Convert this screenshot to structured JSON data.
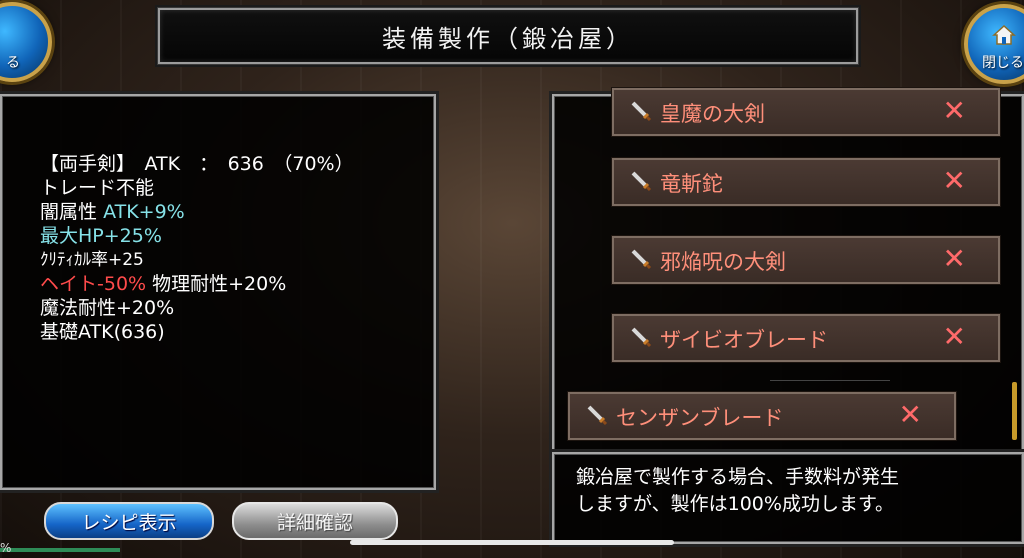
{
  "header": {
    "title": "装備製作（鍛冶屋）"
  },
  "nav": {
    "left_button_label": "る",
    "right_button_label": "閉じる",
    "right_button_icon": "home-icon"
  },
  "item_details": {
    "lines": [
      "【両手剣】　ATK　：　636　（70%）",
      "トレード不能",
      "闇属性",
      "ATK+9%",
      "最大HP+25%",
      "ｸﾘﾃｨｶﾙ率+25",
      "ヘイト-50%",
      "物理耐性+20%",
      "魔法耐性+20%",
      "基礎ATK(636)"
    ]
  },
  "recipes": [
    {
      "name": "皇魔の大剣",
      "remove": "✕"
    },
    {
      "name": "竜斬鉈",
      "remove": "✕"
    },
    {
      "name": "邪焔呪の大剣",
      "remove": "✕"
    },
    {
      "name": "ザイビオブレード",
      "remove": "✕"
    },
    {
      "name": "センザンブレード",
      "remove": "✕"
    }
  ],
  "info": {
    "line1": "鍛冶屋で製作する場合、手数料が発生",
    "line2": "しますが、製作は100%成功します。"
  },
  "buttons": {
    "recipe_display": "レシピ表示",
    "detail_confirm": "詳細確認"
  },
  "edge_text": "%",
  "colors": {
    "accent_blue": "#1565c8",
    "recipe_text": "#ff8f7a",
    "remove_x": "#ff6a6a",
    "stat_cyan": "#86e2e8",
    "stat_red": "#ff4b4b",
    "gold": "#c9a24a"
  }
}
